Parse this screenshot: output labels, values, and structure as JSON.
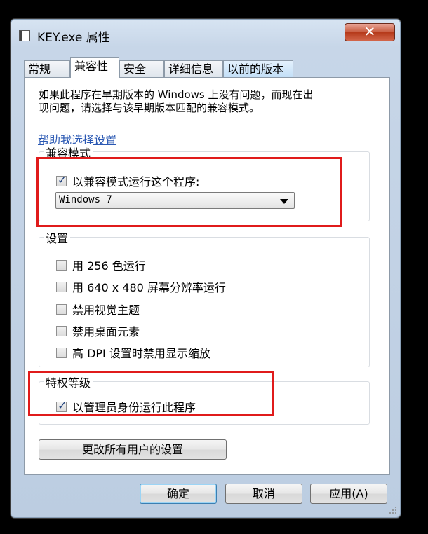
{
  "window": {
    "title": "KEY.exe 属性",
    "close_glyph": "✕"
  },
  "tabs": [
    {
      "label": "常规"
    },
    {
      "label": "兼容性"
    },
    {
      "label": "安全"
    },
    {
      "label": "详细信息"
    },
    {
      "label": "以前的版本"
    }
  ],
  "description": {
    "line1": "如果此程序在早期版本的 Windows 上没有问题，而现在出",
    "line2": "现问题，请选择与该早期版本匹配的兼容模式。"
  },
  "help_link": "帮助我选择设置",
  "compat_mode": {
    "title": "兼容模式",
    "checkbox_label": "以兼容模式运行这个程序:",
    "checked": true,
    "selected_os": "Windows 7"
  },
  "settings": {
    "title": "设置",
    "items": [
      {
        "label": "用 256 色运行",
        "checked": false
      },
      {
        "label": "用 640 x 480 屏幕分辨率运行",
        "checked": false
      },
      {
        "label": "禁用视觉主题",
        "checked": false
      },
      {
        "label": "禁用桌面元素",
        "checked": false
      },
      {
        "label": "高 DPI 设置时禁用显示缩放",
        "checked": false
      }
    ]
  },
  "privilege": {
    "title": "特权等级",
    "checkbox_label": "以管理员身份运行此程序",
    "checked": true
  },
  "change_all_button": "更改所有用户的设置",
  "footer": {
    "ok": "确定",
    "cancel": "取消",
    "apply": "应用(A)"
  },
  "colors": {
    "highlight": "#e01b1b",
    "link": "#2a58b3"
  }
}
